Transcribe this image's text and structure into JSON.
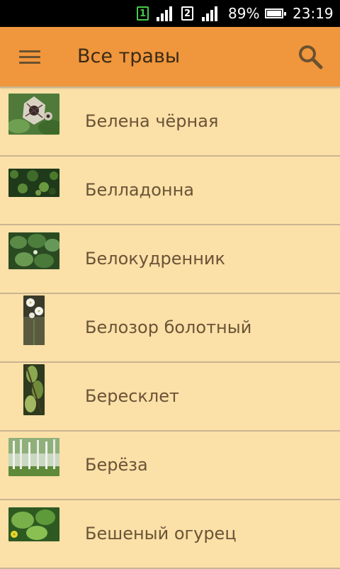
{
  "status_bar": {
    "sim1": "1",
    "sim2": "2",
    "battery_percent": "89%",
    "battery_level": 0.89,
    "time": "23:19",
    "sim1_color": "#47c84a"
  },
  "toolbar": {
    "title": "Все травы",
    "menu_icon": "hamburger-menu-icon",
    "search_icon": "search-icon",
    "background": "#f0963c"
  },
  "list": {
    "items": [
      {
        "label": "Белена чёрная",
        "thumb": "henbane-flower"
      },
      {
        "label": "Белладонна",
        "thumb": "belladonna-bush"
      },
      {
        "label": "Белокудренник",
        "thumb": "ballota-leaves"
      },
      {
        "label": "Белозор болотный",
        "thumb": "grass-of-parnassus"
      },
      {
        "label": "Бересклет",
        "thumb": "euonymus-branch"
      },
      {
        "label": "Берёза",
        "thumb": "birch-grove"
      },
      {
        "label": "Бешеный огурец",
        "thumb": "squirting-cucumber"
      }
    ],
    "background": "#fbe0a8",
    "divider_color": "#c9b590"
  }
}
